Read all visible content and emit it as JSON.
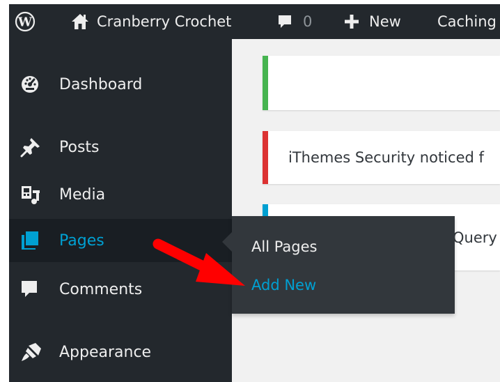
{
  "adminbar": {
    "site_name": "Cranberry Crochet",
    "comments_count": "0",
    "new_label": "New",
    "caching_label": "Caching"
  },
  "sidebar": {
    "items": [
      {
        "label": "Dashboard",
        "icon": "dashboard-icon"
      },
      {
        "label": "Posts",
        "icon": "pin-icon"
      },
      {
        "label": "Media",
        "icon": "media-icon"
      },
      {
        "label": "Pages",
        "icon": "pages-icon"
      },
      {
        "label": "Comments",
        "icon": "comment-icon"
      },
      {
        "label": "Appearance",
        "icon": "brush-icon"
      }
    ]
  },
  "submenu": {
    "items": [
      {
        "label": "All Pages"
      },
      {
        "label": "Add New"
      }
    ]
  },
  "notices": [
    {
      "text": "",
      "color": "#46b450"
    },
    {
      "text": "iThemes Security noticed f",
      "color": "#dc3232"
    },
    {
      "text": "Query",
      "color": "#00a0d2"
    }
  ],
  "colors": {
    "admin_bar": "#23282d",
    "menu_text": "#eeeeee",
    "highlight": "#00a0d2",
    "annotation_arrow": "#ff0000"
  }
}
